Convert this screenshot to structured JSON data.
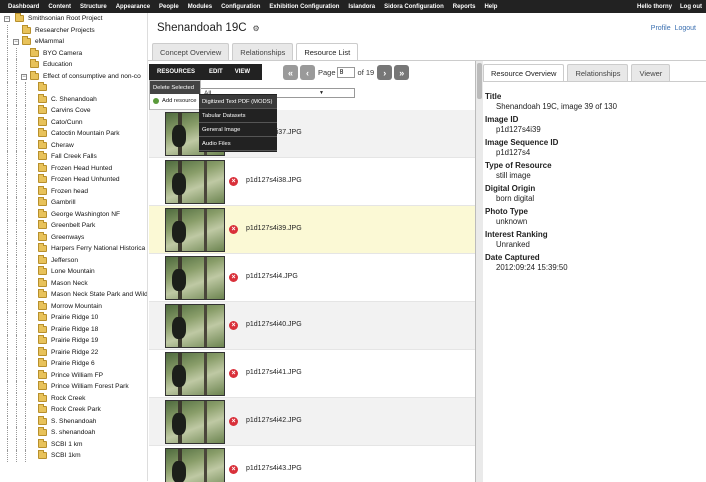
{
  "topbar": {
    "menu": [
      "Dashboard",
      "Content",
      "Structure",
      "Appearance",
      "People",
      "Modules",
      "Configuration",
      "Exhibition Configuration",
      "Islandora",
      "Sidora Configuration",
      "Reports",
      "Help"
    ],
    "greeting": "Hello thorny",
    "logout": "Log out"
  },
  "tree": {
    "root": "Smithsonian Root Project",
    "level1": [
      "Researcher Projects",
      "eMammal"
    ],
    "level2": [
      "BYO Camera",
      "Education",
      "Effect of consumptive and non-co"
    ],
    "sites": [
      "",
      "C. Shenandoah",
      "Carvins Cove",
      "Cato/Cunn",
      "Catoctin Mountain Park",
      "Cheraw",
      "Fall Creek Falls",
      "Frozen Head Hunted",
      "Frozen Head Unhunted",
      "Frozen head",
      "Gambrill",
      "George Washington NF",
      "Greenbelt Park",
      "Greenways",
      "Harpers Ferry National Historica",
      "Jefferson",
      "Lone Mountain",
      "Mason Neck",
      "Mason Neck State Park and Wild",
      "Morrow Mountain",
      "Prairie Ridge 10",
      "Prairie Ridge 18",
      "Prairie Ridge 19",
      "Prairie Ridge 22",
      "Prairie Ridge 6",
      "Prince William FP",
      "Prince William Forest Park",
      "Rock Creek",
      "Rock Creek Park",
      "S. Shenandoah",
      "S. shenandoah",
      "SCBI 1 km",
      "SCBI 1km"
    ]
  },
  "header": {
    "title": "Shenandoah 19C",
    "gear": "⚙",
    "profile": "Profile",
    "logout": "Logout"
  },
  "tabs": [
    "Concept Overview",
    "Relationships",
    "Resource List"
  ],
  "toolbar": {
    "resources": "RESOURCES",
    "edit": "EDIT",
    "view": "VIEW"
  },
  "dropdown": {
    "delete": "Delete Selected",
    "add": "Add resource",
    "types": [
      "Digitized Text PDF (MODS)",
      "Tabular Datasets",
      "General Image",
      "Audio Files"
    ]
  },
  "pager": {
    "first": "«",
    "prev": "‹",
    "label": "Page",
    "current": "8",
    "of": "of 19",
    "next": "›",
    "last": "»"
  },
  "filter": {
    "value": "All"
  },
  "resources": [
    "p1d127s4i37.JPG",
    "p1d127s4i38.JPG",
    "p1d127s4i39.JPG",
    "p1d127s4i4.JPG",
    "p1d127s4i40.JPG",
    "p1d127s4i41.JPG",
    "p1d127s4i42.JPG",
    "p1d127s4i43.JPG"
  ],
  "selected_index": 2,
  "right_tabs": [
    "Resource Overview",
    "Relationships",
    "Viewer"
  ],
  "fields": [
    {
      "label": "Title",
      "value": "Shenandoah 19C, image 39 of 130"
    },
    {
      "label": "Image ID",
      "value": "p1d127s4i39"
    },
    {
      "label": "Image Sequence ID",
      "value": "p1d127s4"
    },
    {
      "label": "Type of Resource",
      "value": "still image"
    },
    {
      "label": "Digital Origin",
      "value": "born digital"
    },
    {
      "label": "Photo Type",
      "value": "unknown"
    },
    {
      "label": "Interest Ranking",
      "value": "Unranked"
    },
    {
      "label": "Date Captured",
      "value": "2012:09:24 15:39:50"
    }
  ],
  "colors": {
    "topbar": "#222222",
    "link": "#3a6fb0",
    "selected_row": "#fbf9d5",
    "delete": "#d9303a",
    "folder": "#e8c25a"
  }
}
